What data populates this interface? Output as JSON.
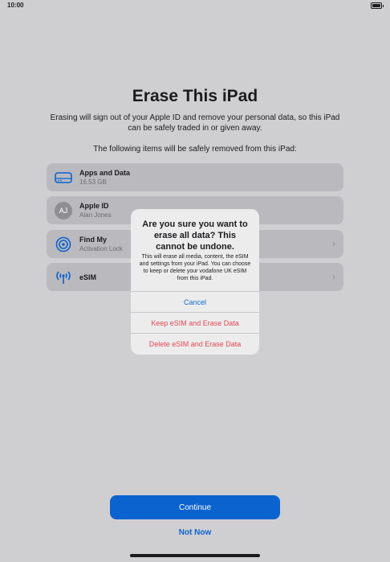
{
  "status_bar": {
    "time": "10:00"
  },
  "page": {
    "title": "Erase This iPad",
    "subtitle": "Erasing will sign out of your Apple ID and remove your personal data, so this iPad can be safely traded in or given away.",
    "items_heading": "The following items will be safely removed from this iPad:"
  },
  "items": [
    {
      "icon": "storage-icon",
      "label": "Apps and Data",
      "sub": "16.53 GB"
    },
    {
      "icon": "avatar",
      "initials": "AJ",
      "label": "Apple ID",
      "sub": "Alan Jones"
    },
    {
      "icon": "find-my-icon",
      "label": "Find My",
      "sub": "Activation Lock"
    },
    {
      "icon": "esim-icon",
      "label": "eSIM",
      "sub": ""
    }
  ],
  "alert": {
    "title": "Are you sure you want to erase all data? This cannot be undone.",
    "message": "This will erase all media, content, the eSIM and settings from your iPad. You can choose to keep or delete your vodafone UK eSIM from this iPad.",
    "buttons": {
      "cancel": "Cancel",
      "keep": "Keep eSIM and Erase Data",
      "delete": "Delete eSIM and Erase Data"
    }
  },
  "footer": {
    "continue": "Continue",
    "not_now": "Not Now"
  },
  "colors": {
    "accent": "#0b63cf",
    "destructive": "#e5484d",
    "background": "#cfcfd1",
    "row": "#b9b9be"
  }
}
